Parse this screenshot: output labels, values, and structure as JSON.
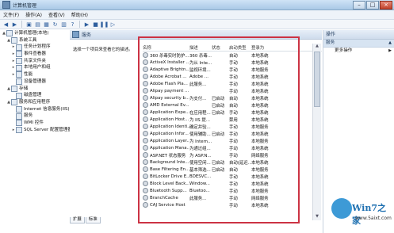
{
  "window": {
    "title": "计算机管理"
  },
  "menu": [
    "文件(F)",
    "操作(A)",
    "查看(V)",
    "帮助(H)"
  ],
  "tree": [
    {
      "label": "计算机管理(本地)",
      "level": 0,
      "exp": "▲"
    },
    {
      "label": "系统工具",
      "level": 1,
      "exp": "▲"
    },
    {
      "label": "任务计划程序",
      "level": 2,
      "exp": "▸"
    },
    {
      "label": "事件查看器",
      "level": 2,
      "exp": "▸"
    },
    {
      "label": "共享文件夹",
      "level": 2,
      "exp": "▸"
    },
    {
      "label": "本地用户和组",
      "level": 2,
      "exp": "▸"
    },
    {
      "label": "性能",
      "level": 2,
      "exp": "▸"
    },
    {
      "label": "设备管理器",
      "level": 2,
      "exp": ""
    },
    {
      "label": "存储",
      "level": 1,
      "exp": "▲"
    },
    {
      "label": "磁盘管理",
      "level": 2,
      "exp": ""
    },
    {
      "label": "服务和应用程序",
      "level": 1,
      "exp": "▲"
    },
    {
      "label": "Internet 信息服务(IIS)",
      "level": 2,
      "exp": ""
    },
    {
      "label": "服务",
      "level": 2,
      "exp": ""
    },
    {
      "label": "WMI 控件",
      "level": 2,
      "exp": ""
    },
    {
      "label": "SQL Server 配置管理器",
      "level": 2,
      "exp": "▸"
    }
  ],
  "main": {
    "header": "服务",
    "description": "选择一个项目来查看它的描述。",
    "columns": [
      "名称",
      "描述",
      "状态",
      "启动类型",
      "登录为"
    ],
    "rows": [
      [
        "360 杀毒实时防护...",
        "360 杀毒...",
        "",
        "自动",
        "本地系统"
      ],
      [
        "ActiveX Installer ...",
        "为从 Inte...",
        "",
        "手动",
        "本地系统"
      ],
      [
        "Adaptive Brightn...",
        "监视环境...",
        "",
        "手动",
        "本地服务"
      ],
      [
        "Adobe Acrobat ...",
        "Adobe ...",
        "",
        "手动",
        "本地系统"
      ],
      [
        "Adobe Flash Pla...",
        "此服务...",
        "",
        "手动",
        "本地系统"
      ],
      [
        "Alipay payment ...",
        "",
        "",
        "手动",
        "本地系统"
      ],
      [
        "Alipay security b...",
        "为支付...",
        "已启动",
        "自动",
        "本地系统"
      ],
      [
        "AMD External Ev...",
        "",
        "已启动",
        "自动",
        "本地系统"
      ],
      [
        "Application Expe...",
        "在应用程...",
        "已启动",
        "手动",
        "本地系统"
      ],
      [
        "Application Host...",
        "为 IIS 提...",
        "",
        "禁用",
        "本地系统"
      ],
      [
        "Application Identi...",
        "确定并验...",
        "",
        "手动",
        "本地服务"
      ],
      [
        "Application Infor...",
        "使用辅助...",
        "已启动",
        "手动",
        "本地系统"
      ],
      [
        "Application Layer...",
        "为 Intern...",
        "",
        "手动",
        "本地服务"
      ],
      [
        "Application Mana...",
        "为通过组...",
        "",
        "手动",
        "本地系统"
      ],
      [
        "ASP.NET 状态服务",
        "为 ASP.N...",
        "",
        "手动",
        "网络服务"
      ],
      [
        "Background Inte...",
        "使用空闲...",
        "已启动",
        "自动(延迟...",
        "本地系统"
      ],
      [
        "Base Filtering En...",
        "基本筛选...",
        "已启动",
        "自动",
        "本地服务"
      ],
      [
        "BitLocker Drive E...",
        "BDESVC...",
        "",
        "手动",
        "本地系统"
      ],
      [
        "Block Level Back...",
        "Window...",
        "",
        "手动",
        "本地系统"
      ],
      [
        "Bluetooth Supp...",
        "Bluetoo...",
        "",
        "手动",
        "本地服务"
      ],
      [
        "BranchCache",
        "此服务...",
        "",
        "手动",
        "网络服务"
      ],
      [
        "CAJ Service Host",
        "",
        "",
        "手动",
        "本地系统"
      ]
    ],
    "tabs": [
      "扩展",
      "标准"
    ]
  },
  "actions": {
    "header": "操作",
    "section": "服务",
    "more": "更多操作"
  },
  "watermark": {
    "brand": "Win7之家",
    "url": "www.5aixt.com"
  }
}
